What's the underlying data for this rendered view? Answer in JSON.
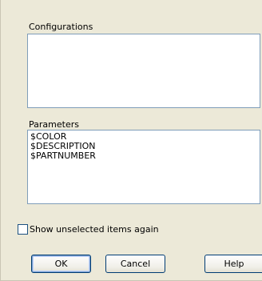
{
  "configurations": {
    "label": "Configurations",
    "items": []
  },
  "parameters": {
    "label": "Parameters",
    "items": [
      "$COLOR",
      "$DESCRIPTION",
      "$PARTNUMBER"
    ]
  },
  "show_unselected": {
    "label": "Show unselected items again",
    "checked": false
  },
  "buttons": {
    "ok_label": "OK",
    "cancel_label": "Cancel",
    "help_label": "Help"
  }
}
